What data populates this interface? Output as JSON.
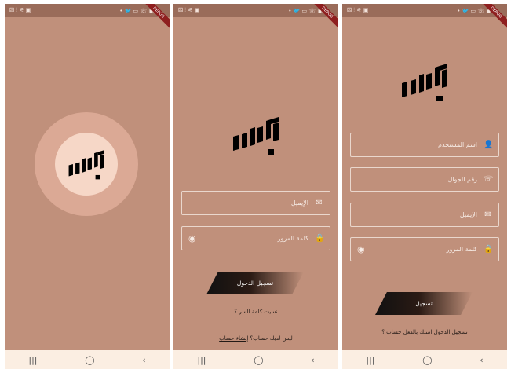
{
  "status_bar": {
    "left": "⚄ ⫶ ⚟ ▣",
    "right": "• 🐦 ▭ ☏ ▣",
    "debug_label": "DEBUG"
  },
  "nav_bar": {
    "recent": "|||",
    "home": "◯",
    "back": "‹"
  },
  "login": {
    "email_placeholder": "الإيميل",
    "password_placeholder": "كلمة المرور",
    "login_button": "تسجيل الدخول",
    "forgot_password": "نسيت كلمة السر ؟",
    "no_account_text": "ليس لديك حساب؟",
    "create_account_link": "إنشاء حساب"
  },
  "register": {
    "username_placeholder": "اسم المستخدم",
    "phone_placeholder": "رقم الجوال",
    "email_placeholder": "الإيميل",
    "password_placeholder": "كلمة المرور",
    "register_button": "تسجيل",
    "have_account_text": "امتلك بالفعل حساب ؟",
    "login_link": "تسجيل الدخول"
  },
  "colors": {
    "background": "#c0907b",
    "status_bar": "#9a6c5a",
    "nav_bar": "#fbeee2",
    "splash_outer": "#dba995",
    "splash_inner": "#f6d7c7"
  }
}
